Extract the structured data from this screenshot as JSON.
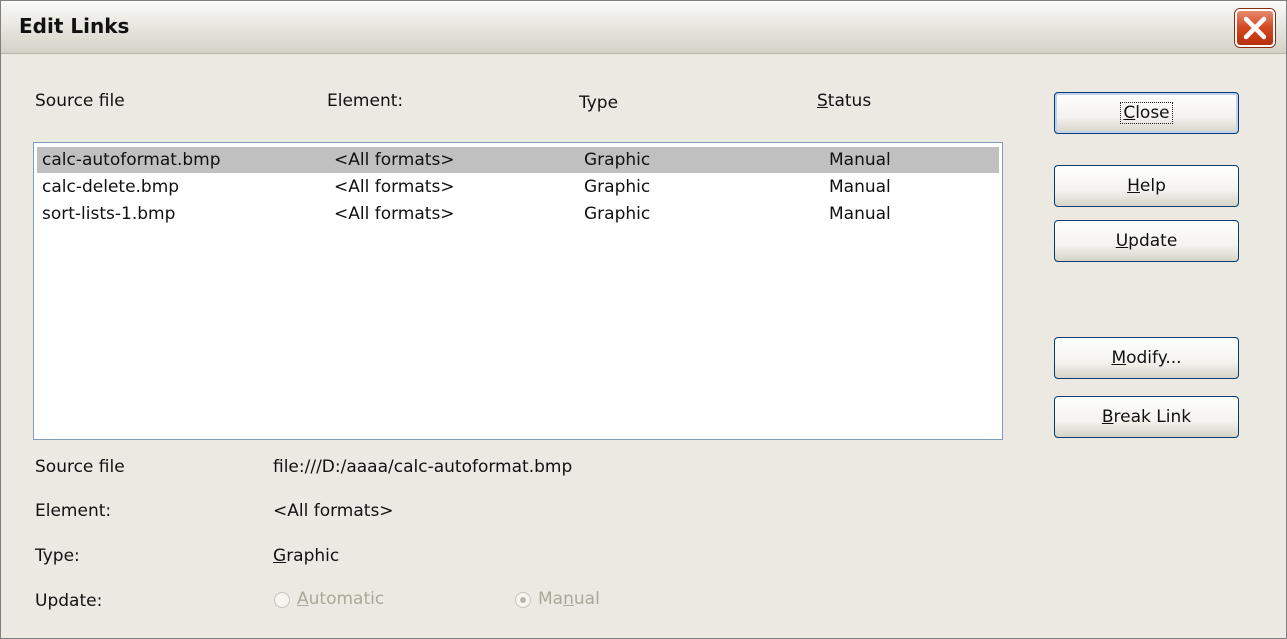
{
  "window": {
    "title": "Edit Links"
  },
  "list": {
    "headers": {
      "source": "Source file",
      "element": "Element:",
      "type": "Type",
      "status_prefix": "S",
      "status_rest": "tatus"
    },
    "rows": [
      {
        "source": "calc-autoformat.bmp",
        "element": "<All formats>",
        "type": "Graphic",
        "status": "Manual",
        "selected": true
      },
      {
        "source": "calc-delete.bmp",
        "element": "<All formats>",
        "type": "Graphic",
        "status": "Manual",
        "selected": false
      },
      {
        "source": "sort-lists-1.bmp",
        "element": "<All formats>",
        "type": "Graphic",
        "status": "Manual",
        "selected": false
      }
    ]
  },
  "buttons": {
    "close": {
      "mn": "C",
      "rest": "lose"
    },
    "help": {
      "mn": "H",
      "rest": "elp"
    },
    "update": {
      "mn": "U",
      "rest": "pdate"
    },
    "modify": {
      "mn": "M",
      "rest": "odify..."
    },
    "break_link": {
      "mn": "B",
      "rest": "reak Link"
    }
  },
  "details": {
    "source_label": "Source file",
    "source_value": "file:///D:/aaaa/calc-autoformat.bmp",
    "element_label": "Element:",
    "element_value": "<All formats>",
    "type_label": "Type:",
    "type_value_mn": "G",
    "type_value_rest": "raphic",
    "update_label": "Update:",
    "automatic_mn": "A",
    "automatic_rest": "utomatic",
    "manual_pre": "Ma",
    "manual_mn": "n",
    "manual_rest": "ual"
  },
  "icons": {
    "close": "close-x-icon"
  },
  "colors": {
    "dialog_bg": "#ebe9e2",
    "selection": "#c0c0c0",
    "close_red": "#d2471f"
  }
}
